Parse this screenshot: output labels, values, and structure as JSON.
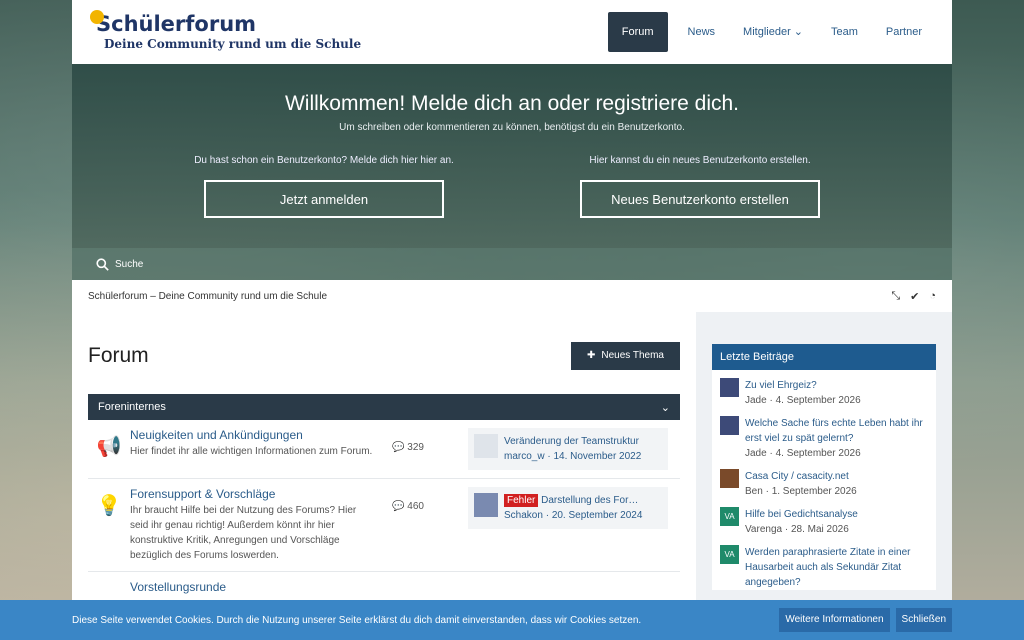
{
  "header": {
    "logo_title": "Schülerforum",
    "logo_tagline": "Deine Community rund um die Schule",
    "nav": [
      "Forum",
      "News",
      "Mitglieder",
      "Team",
      "Partner"
    ]
  },
  "hero": {
    "title": "Willkommen! Melde dich an oder registriere dich.",
    "subtitle": "Um schreiben oder kommentieren zu können, benötigst du ein Benutzerkonto.",
    "login_text": "Du hast schon ein Benutzerkonto? Melde dich hier hier an.",
    "login_button": "Jetzt anmelden",
    "register_text": "Hier kannst du ein neues Benutzerkonto erstellen.",
    "register_button": "Neues Benutzerkonto erstellen"
  },
  "search": {
    "label": "Suche"
  },
  "breadcrumb": "Schülerforum – Deine Community rund um die Schule",
  "forum": {
    "title": "Forum",
    "new_thread": "Neues Thema",
    "category": "Foreninternes",
    "rows": [
      {
        "title": "Neuigkeiten und Ankündigungen",
        "desc": "Hier findet ihr alle wichtigen Informationen zum Forum.",
        "count": "329",
        "last_title": "Veränderung der Teamstruktur",
        "last_user": "marco_w",
        "last_date": "14. November 2022"
      },
      {
        "title": "Forensupport & Vorschläge",
        "desc": "Ihr braucht Hilfe bei der Nutzung des Forums? Hier seid ihr genau richtig! Außerdem könnt ihr hier konstruktive Kritik, Anregungen und Vorschläge bezüglich des Forums loswerden.",
        "count": "460",
        "last_badge": "Fehler",
        "last_title": "Darstellung des For…",
        "last_user": "Schakon",
        "last_date": "20. September 2024"
      },
      {
        "title": "Vorstellungsrunde"
      }
    ]
  },
  "sidebar": {
    "title": "Letzte Beiträge",
    "items": [
      {
        "title": "Zu viel Ehrgeiz?",
        "user": "Jade",
        "date": "4. September 2026"
      },
      {
        "title": "Welche Sache fürs echte Leben habt ihr erst viel zu spät gelernt?",
        "user": "Jade",
        "date": "4. September 2026"
      },
      {
        "title": "Casa City / casacity.net",
        "user": "Ben",
        "date": "1. September 2026"
      },
      {
        "title": "Hilfe bei Gedichtsanalyse",
        "user": "Varenga",
        "date": "28. Mai 2026",
        "avatar": "VA"
      },
      {
        "title": "Werden paraphrasierte Zitate in einer Hausarbeit auch als Sekundär Zitat angegeben?",
        "avatar": "VA"
      }
    ]
  },
  "cookie": {
    "text": "Diese Seite verwendet Cookies. Durch die Nutzung unserer Seite erklärst du dich damit einverstanden, dass wir Cookies setzen.",
    "more": "Weitere Informationen",
    "close": "Schließen"
  }
}
